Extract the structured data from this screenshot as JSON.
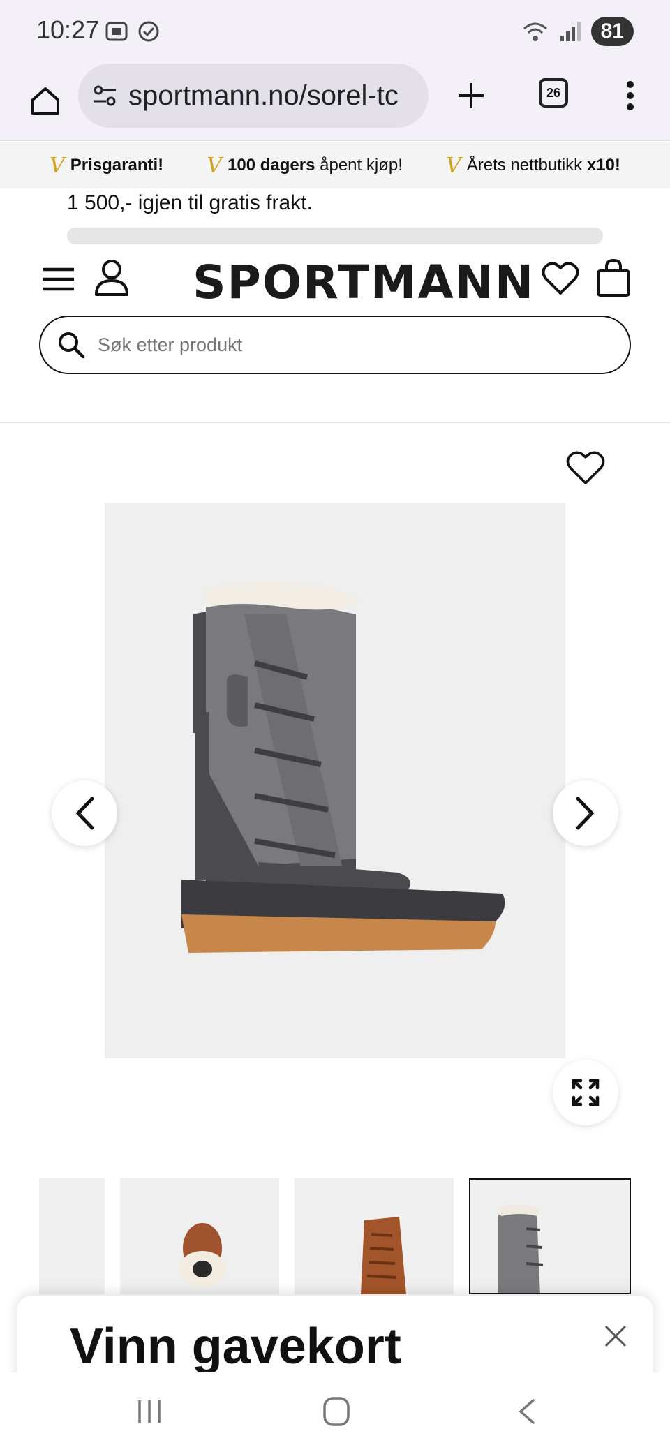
{
  "status_bar": {
    "time": "10:27",
    "battery": "81"
  },
  "browser": {
    "url": "sportmann.no/sorel-tc",
    "tab_count": "26"
  },
  "usp": [
    {
      "mark": "V",
      "bold": "Prisgaranti!",
      "rest": ""
    },
    {
      "mark": "V",
      "bold": "100 dagers",
      "rest": " åpent kjøp!"
    },
    {
      "mark": "V",
      "bold": "",
      "rest": "Årets nettbutikk ",
      "bold_end": "x10!"
    }
  ],
  "shipping": {
    "text": "1 500,- igjen til gratis frakt.",
    "progress": 0
  },
  "header": {
    "logo": "SPORTMANN"
  },
  "search": {
    "placeholder": "Søk etter produkt"
  },
  "popup": {
    "title": "Vinn gavekort"
  },
  "colors": {
    "accent_gold": "#d3a21a",
    "text": "#111111",
    "image_bg": "#efefef"
  }
}
